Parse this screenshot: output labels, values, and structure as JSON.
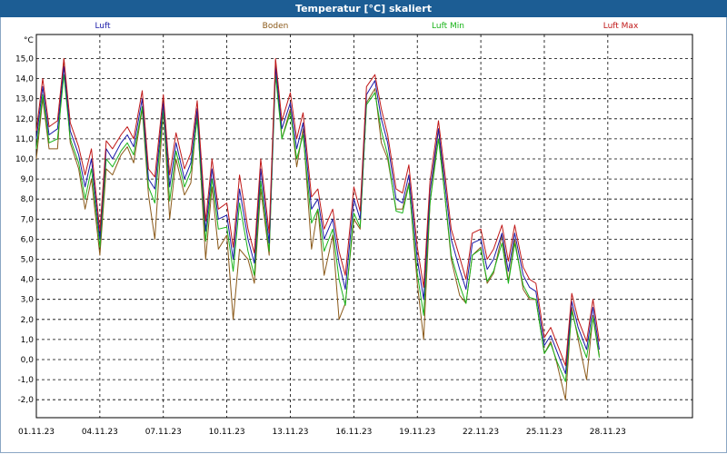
{
  "window": {
    "title": "Temperatur [°C] skaliert",
    "colors": {
      "titlebar": "#1c5d94",
      "border": "#8aa6c4"
    }
  },
  "chart_data": {
    "type": "line",
    "title": "Temperatur [°C] skaliert",
    "unit_label": "°C",
    "ylim": [
      -3.0,
      16.0
    ],
    "y_ticks": [
      "15,0",
      "14,0",
      "13,0",
      "12,0",
      "11,0",
      "10,0",
      "9,0",
      "8,0",
      "7,0",
      "6,0",
      "5,0",
      "4,0",
      "3,0",
      "2,0",
      "1,0",
      "0,0",
      "-1,0",
      "-2,0"
    ],
    "x_range_days": [
      0,
      31
    ],
    "x_ticks": [
      {
        "day": 0,
        "label": "01.11.23"
      },
      {
        "day": 3,
        "label": "04.11.23"
      },
      {
        "day": 6,
        "label": "07.11.23"
      },
      {
        "day": 9,
        "label": "10.11.23"
      },
      {
        "day": 12,
        "label": "13.11.23"
      },
      {
        "day": 15,
        "label": "16.11.23"
      },
      {
        "day": 18,
        "label": "19.11.23"
      },
      {
        "day": 21,
        "label": "22.11.23"
      },
      {
        "day": 24,
        "label": "25.11.23"
      },
      {
        "day": 27,
        "label": "28.11.23"
      }
    ],
    "grid": true,
    "legend_position": "top",
    "x": [
      0,
      0.3,
      0.6,
      1,
      1.3,
      1.6,
      2,
      2.3,
      2.6,
      3,
      3.3,
      3.6,
      4,
      4.3,
      4.6,
      5,
      5.3,
      5.6,
      6,
      6.3,
      6.6,
      7,
      7.3,
      7.6,
      8,
      8.3,
      8.6,
      9,
      9.3,
      9.6,
      10,
      10.3,
      10.6,
      11,
      11.3,
      11.6,
      12,
      12.3,
      12.6,
      13,
      13.3,
      13.6,
      14,
      14.3,
      14.6,
      15,
      15.3,
      15.6,
      16,
      16.3,
      16.6,
      17,
      17.3,
      17.6,
      18,
      18.3,
      18.6,
      19,
      19.3,
      19.6,
      20,
      20.3,
      20.6,
      21,
      21.3,
      21.6,
      22,
      22.3,
      22.6,
      23,
      23.3,
      23.6,
      24,
      24.3,
      24.6,
      25,
      25.3,
      25.6,
      26,
      26.3,
      26.6,
      27,
      27.3,
      27.6,
      28,
      28.3,
      28.6,
      29,
      29.3,
      29.6,
      30,
      30.3,
      30.6,
      31
    ],
    "series": [
      {
        "name": "Luft",
        "color": "#1a1aa8",
        "values": [
          11.0,
          13.6,
          11.2,
          11.5,
          14.6,
          11.4,
          10.2,
          8.6,
          10.0,
          6.0,
          10.5,
          10.0,
          10.8,
          11.2,
          10.6,
          13.0,
          9.0,
          8.5,
          12.8,
          8.6,
          10.8,
          9.0,
          9.8,
          12.5,
          6.4,
          9.5,
          7.0,
          7.2,
          5.0,
          8.5,
          6.0,
          4.8,
          9.5,
          5.8,
          14.6,
          11.5,
          12.8,
          10.5,
          11.8,
          7.5,
          8.0,
          6.0,
          7.0,
          4.8,
          3.5,
          8.0,
          7.0,
          13.2,
          13.9,
          12.0,
          10.8,
          8.0,
          7.8,
          9.2,
          5.0,
          3.0,
          8.4,
          11.5,
          8.8,
          6.0,
          4.5,
          3.5,
          5.8,
          6.0,
          4.5,
          5.0,
          6.3,
          4.4,
          6.3,
          4.2,
          3.6,
          3.4,
          0.7,
          1.2,
          0.4,
          -0.7,
          2.9,
          1.6,
          0.5,
          2.6,
          0.5
        ]
      },
      {
        "name": "Boden",
        "color": "#8b5a1a",
        "values": [
          10.0,
          13.0,
          10.5,
          10.5,
          15.0,
          10.8,
          9.5,
          7.5,
          9.0,
          5.2,
          9.5,
          9.2,
          10.2,
          10.6,
          9.8,
          12.5,
          8.2,
          6.0,
          12.5,
          7.0,
          10.0,
          8.2,
          8.8,
          12.3,
          5.0,
          8.6,
          5.5,
          6.2,
          2.0,
          5.5,
          5.0,
          3.8,
          8.5,
          5.2,
          14.9,
          11.0,
          12.5,
          9.6,
          11.5,
          5.5,
          7.5,
          4.2,
          6.2,
          2.0,
          2.8,
          7.0,
          6.5,
          12.8,
          13.5,
          10.8,
          10.0,
          7.5,
          7.5,
          8.8,
          3.8,
          1.0,
          7.8,
          11.5,
          8.2,
          5.0,
          3.2,
          2.8,
          5.2,
          5.6,
          3.8,
          4.3,
          6.2,
          3.9,
          6.0,
          3.5,
          3.0,
          3.0,
          0.3,
          0.9,
          -0.2,
          -2.0,
          2.6,
          1.0,
          -1.0,
          2.2,
          0.2
        ]
      },
      {
        "name": "Luft Min",
        "color": "#19b319",
        "values": [
          10.5,
          13.2,
          10.8,
          11.0,
          14.2,
          11.0,
          9.8,
          8.0,
          9.5,
          5.6,
          10.0,
          9.6,
          10.4,
          10.8,
          10.2,
          12.6,
          8.6,
          7.8,
          12.5,
          7.9,
          10.4,
          8.6,
          9.4,
          12.0,
          5.9,
          9.0,
          6.5,
          6.6,
          4.4,
          7.8,
          5.4,
          4.2,
          8.9,
          5.4,
          14.2,
          11.0,
          12.3,
          10.0,
          11.2,
          6.8,
          7.5,
          5.4,
          6.5,
          4.0,
          2.7,
          7.3,
          6.6,
          12.7,
          13.3,
          11.4,
          10.2,
          7.4,
          7.3,
          8.7,
          4.3,
          2.2,
          7.8,
          11.0,
          8.2,
          5.2,
          3.7,
          2.8,
          5.2,
          5.5,
          3.9,
          4.4,
          5.8,
          3.8,
          5.8,
          3.7,
          3.1,
          3.0,
          0.3,
          0.8,
          -0.1,
          -1.1,
          2.4,
          1.2,
          0.1,
          2.1,
          0.1
        ]
      },
      {
        "name": "Luft Max",
        "color": "#c01818",
        "values": [
          11.4,
          14.0,
          11.6,
          11.9,
          15.0,
          11.8,
          10.6,
          9.2,
          10.5,
          6.4,
          10.9,
          10.5,
          11.2,
          11.6,
          11.0,
          13.4,
          9.5,
          9.1,
          13.2,
          9.2,
          11.3,
          9.5,
          10.3,
          12.9,
          6.9,
          10.0,
          7.5,
          7.8,
          5.6,
          9.2,
          6.5,
          5.3,
          10.0,
          6.3,
          15.0,
          11.9,
          13.3,
          11.0,
          12.3,
          8.1,
          8.5,
          6.5,
          7.5,
          5.4,
          4.2,
          8.6,
          7.4,
          13.6,
          14.2,
          12.5,
          11.2,
          8.5,
          8.3,
          9.7,
          5.6,
          3.6,
          8.9,
          11.9,
          9.3,
          6.5,
          5.1,
          4.0,
          6.3,
          6.5,
          5.0,
          5.5,
          6.7,
          4.9,
          6.7,
          4.6,
          4.0,
          3.8,
          1.1,
          1.6,
          0.8,
          -0.3,
          3.3,
          2.0,
          0.9,
          3.0,
          0.9
        ]
      }
    ]
  }
}
